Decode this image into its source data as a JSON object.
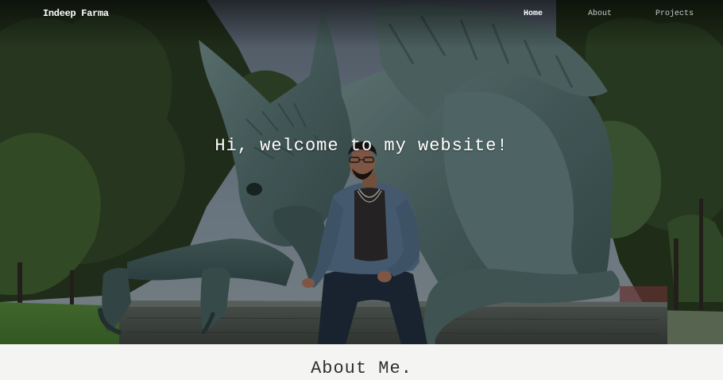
{
  "navbar": {
    "brand": "Indeep Farma",
    "links": [
      {
        "label": "Home",
        "active": true
      },
      {
        "label": "About",
        "active": false
      },
      {
        "label": "Projects",
        "active": false
      }
    ]
  },
  "hero": {
    "title": "Hi, welcome to my website!",
    "photo_description_icon": "griffin-statue-photo"
  },
  "about": {
    "heading": "About Me."
  },
  "colors": {
    "nav_text": "#ffffff",
    "nav_inactive": "#c9cdc8",
    "about_background": "#f4f4f2",
    "about_text": "#2f2f2f"
  }
}
